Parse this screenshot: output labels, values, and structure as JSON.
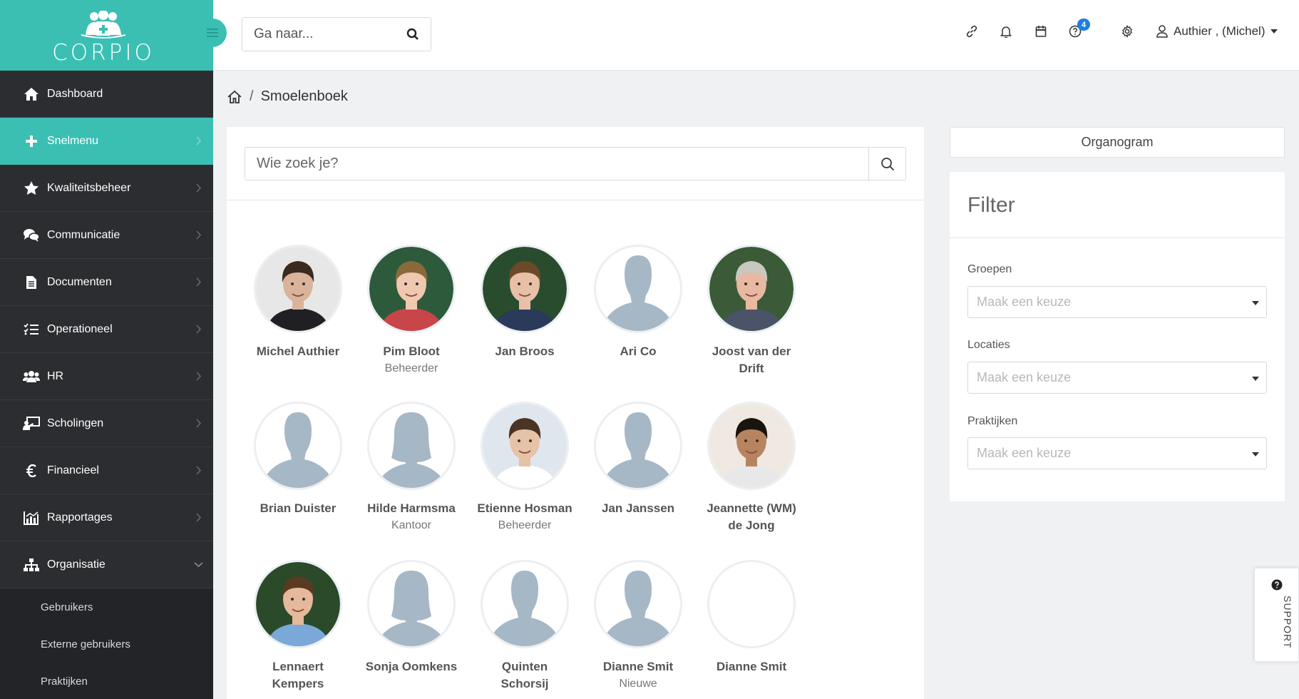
{
  "brand": {
    "name": "CORPIO",
    "color": "#3bbfb3"
  },
  "topbar": {
    "search_placeholder": "Ga naar...",
    "notification_count": "4",
    "user_name": "Authier , (Michel)"
  },
  "sidebar": {
    "items": [
      {
        "label": "Dashboard",
        "icon": "home-icon"
      },
      {
        "label": "Snelmenu",
        "icon": "plus-icon",
        "active": true
      },
      {
        "label": "Kwaliteitsbeheer",
        "icon": "star-icon"
      },
      {
        "label": "Communicatie",
        "icon": "chat-icon"
      },
      {
        "label": "Documenten",
        "icon": "document-icon"
      },
      {
        "label": "Operationeel",
        "icon": "list-check-icon"
      },
      {
        "label": "HR",
        "icon": "users-icon"
      },
      {
        "label": "Scholingen",
        "icon": "training-icon"
      },
      {
        "label": "Financieel",
        "icon": "euro-icon"
      },
      {
        "label": "Rapportages",
        "icon": "chart-icon"
      },
      {
        "label": "Organisatie",
        "icon": "sitemap-icon",
        "expanded": true
      }
    ],
    "subitems": [
      {
        "label": "Gebruikers"
      },
      {
        "label": "Externe gebruikers"
      },
      {
        "label": "Praktijken"
      }
    ]
  },
  "breadcrumb": {
    "current": "Smoelenboek",
    "separator": "/"
  },
  "search": {
    "placeholder": "Wie zoek je?"
  },
  "people": [
    {
      "name": "Michel Authier",
      "role": "",
      "photo": "photo"
    },
    {
      "name": "Pim Bloot",
      "role": "Beheerder",
      "photo": "photo"
    },
    {
      "name": "Jan Broos",
      "role": "",
      "photo": "photo"
    },
    {
      "name": "Ari Co",
      "role": "",
      "photo": "male-placeholder"
    },
    {
      "name": "Joost van der Drift",
      "role": "",
      "photo": "photo"
    },
    {
      "name": "Brian Duister",
      "role": "",
      "photo": "male-placeholder"
    },
    {
      "name": "Hilde Harmsma",
      "role": "Kantoor",
      "photo": "female-placeholder"
    },
    {
      "name": "Etienne Hosman",
      "role": "Beheerder",
      "photo": "photo"
    },
    {
      "name": "Jan Janssen",
      "role": "",
      "photo": "male-placeholder"
    },
    {
      "name": "Jeannette (WM) de Jong",
      "role": "",
      "photo": "photo"
    },
    {
      "name": "Lennaert Kempers",
      "role": "",
      "photo": "photo"
    },
    {
      "name": "Sonja Oomkens",
      "role": "",
      "photo": "female-placeholder"
    },
    {
      "name": "Quinten Schorsij",
      "role": "",
      "photo": "male-placeholder"
    },
    {
      "name": "Dianne Smit",
      "role": "Nieuwe",
      "photo": "male-placeholder"
    },
    {
      "name": "Dianne Smit",
      "role": "",
      "photo": "empty"
    }
  ],
  "organogram": {
    "label": "Organogram"
  },
  "filter": {
    "title": "Filter",
    "fields": [
      {
        "label": "Groepen",
        "placeholder": "Maak een keuze"
      },
      {
        "label": "Locaties",
        "placeholder": "Maak een keuze"
      },
      {
        "label": "Praktijken",
        "placeholder": "Maak een keuze"
      }
    ]
  },
  "support": {
    "label": "SUPPORT"
  }
}
